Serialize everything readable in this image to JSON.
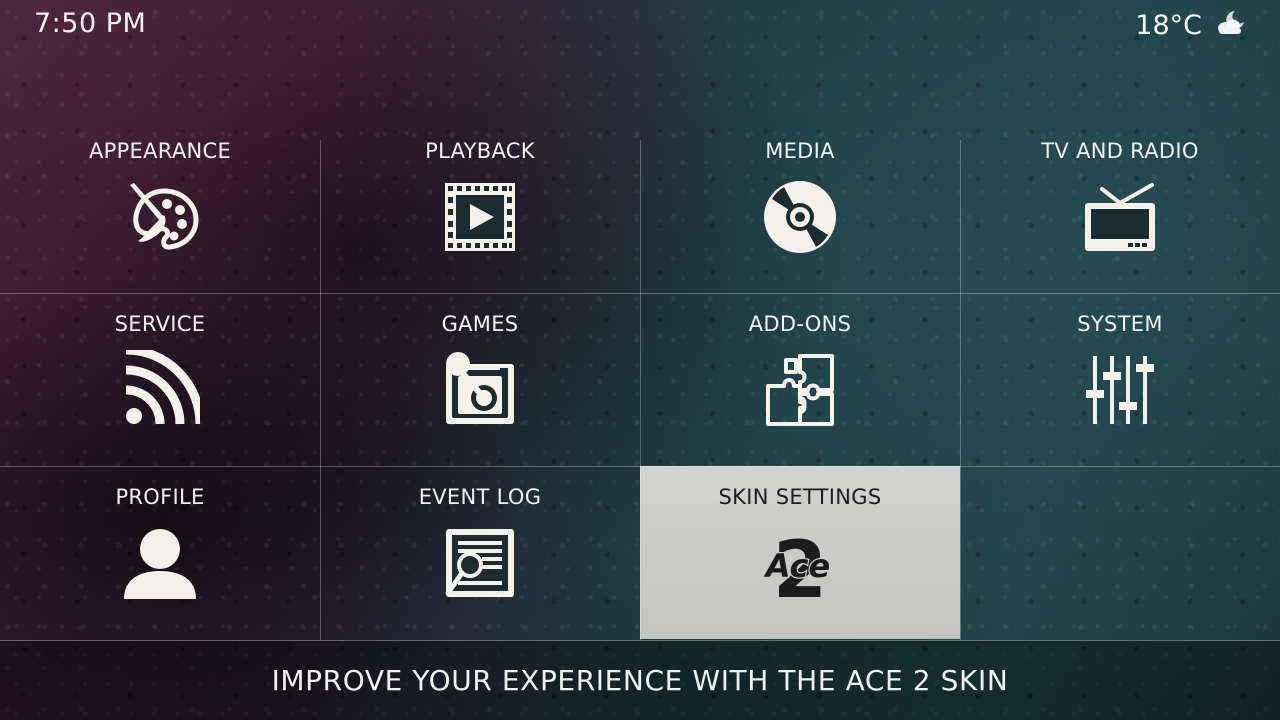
{
  "status_bar": {
    "time": "7:50 PM",
    "temperature": "18°C",
    "weather_icon": "partly-cloudy-night-icon"
  },
  "menu": {
    "tiles": [
      {
        "label": "APPEARANCE",
        "icon": "palette-icon"
      },
      {
        "label": "PLAYBACK",
        "icon": "film-play-icon"
      },
      {
        "label": "MEDIA",
        "icon": "disc-icon"
      },
      {
        "label": "TV AND RADIO",
        "icon": "tv-icon"
      },
      {
        "label": "SERVICE",
        "icon": "wifi-broadcast-icon"
      },
      {
        "label": "GAMES",
        "icon": "joystick-icon"
      },
      {
        "label": "ADD-ONS",
        "icon": "puzzle-icon"
      },
      {
        "label": "SYSTEM",
        "icon": "sliders-icon"
      },
      {
        "label": "PROFILE",
        "icon": "user-icon"
      },
      {
        "label": "EVENT LOG",
        "icon": "log-search-icon"
      },
      {
        "label": "SKIN SETTINGS",
        "icon": "ace2-logo-icon",
        "selected": true
      }
    ],
    "selected_index": 10
  },
  "skin_logo": {
    "text_ace": "Ace",
    "text_2": "2"
  },
  "footer": {
    "description": "IMPROVE YOUR EXPERIENCE WITH THE ACE 2 SKIN"
  },
  "colors": {
    "text": "#f2f2f2",
    "selected_tile": "#c8c8c6",
    "selected_text": "#1e1e1e",
    "grid_line": "#ffffff"
  }
}
